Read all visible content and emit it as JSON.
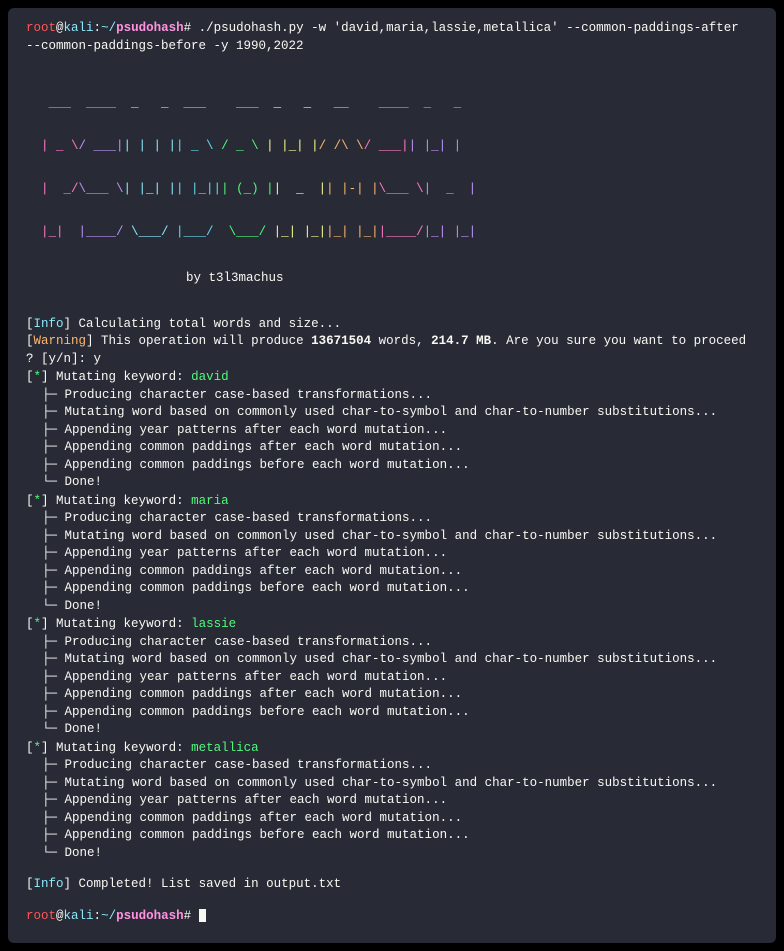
{
  "prompt": {
    "user": "root",
    "at": "@",
    "host": "kali",
    "colon": ":",
    "tilde": "~/",
    "path": "psudohash",
    "hash": "#"
  },
  "commandLine1": " ./psudohash.py -w 'david,maria,lassie,metallica' --common-paddings-after ",
  "commandLine2": "--common-paddings-before -y 1990,2022",
  "byline": "by t3l3machus",
  "info": {
    "tag": "Info",
    "calc": " Calculating total words and size...",
    "done": " Completed! List saved in output.txt"
  },
  "warning": {
    "tag": "Warning",
    "pre": " This operation will produce ",
    "words": "13671504",
    "mid": " words, ",
    "size": "214.7 MB",
    "post": ". Are you sure you want to proceed",
    "prompt": "? [y/n]: y"
  },
  "mutatingLabel": " Mutating keyword: ",
  "keywords": [
    "david",
    "maria",
    "lassie",
    "metallica"
  ],
  "steps": {
    "s1": " Producing character case-based transformations...",
    "s2": " Mutating word based on commonly used char-to-symbol and char-to-number substitutions...",
    "s3": " Appending year patterns after each word mutation...",
    "s4": " Appending common paddings after each word mutation...",
    "s5": " Appending common paddings before each word mutation...",
    "s6": " Done!"
  },
  "tree": {
    "mid": " ├─",
    "last": " └─"
  },
  "star": "*",
  "banner": {
    "l1": {
      "c1": "   ___ ",
      "c2": " ____  ",
      "c3": "_   _  ",
      "c4": "___   ",
      "c5": " ___  ",
      "c6": "_   _  ",
      "c7": " __   ",
      "c8": " ____  ",
      "c9": "_   _ "
    },
    "l2": {
      "c1": "  | _ \\",
      "c2": "/ ___|",
      "c3": "| | | |",
      "c4": "| _ \\ ",
      "c5": "/ _ \\ ",
      "c6": "| |_| |",
      "c7": "/ /\\ \\",
      "c8": "/ ___|",
      "c9": "| |_| |"
    },
    "l3": {
      "c1": "  |  _/",
      "c2": "\\___ \\",
      "c3": "| |_| |",
      "c4": "| |_||",
      "c5": "| (_) |",
      "c6": "|  _  |",
      "c7": "| |-| |",
      "c8": "\\___ \\",
      "c9": "|  _  |"
    },
    "l4": {
      "c1": "  |_|  ",
      "c2": "|____/",
      "c3": " \\___/ ",
      "c4": "|___/ ",
      "c5": " \\___/ ",
      "c6": "|_| |_|",
      "c7": "|_| |_|",
      "c8": "|____/",
      "c9": "|_| |_|"
    }
  }
}
